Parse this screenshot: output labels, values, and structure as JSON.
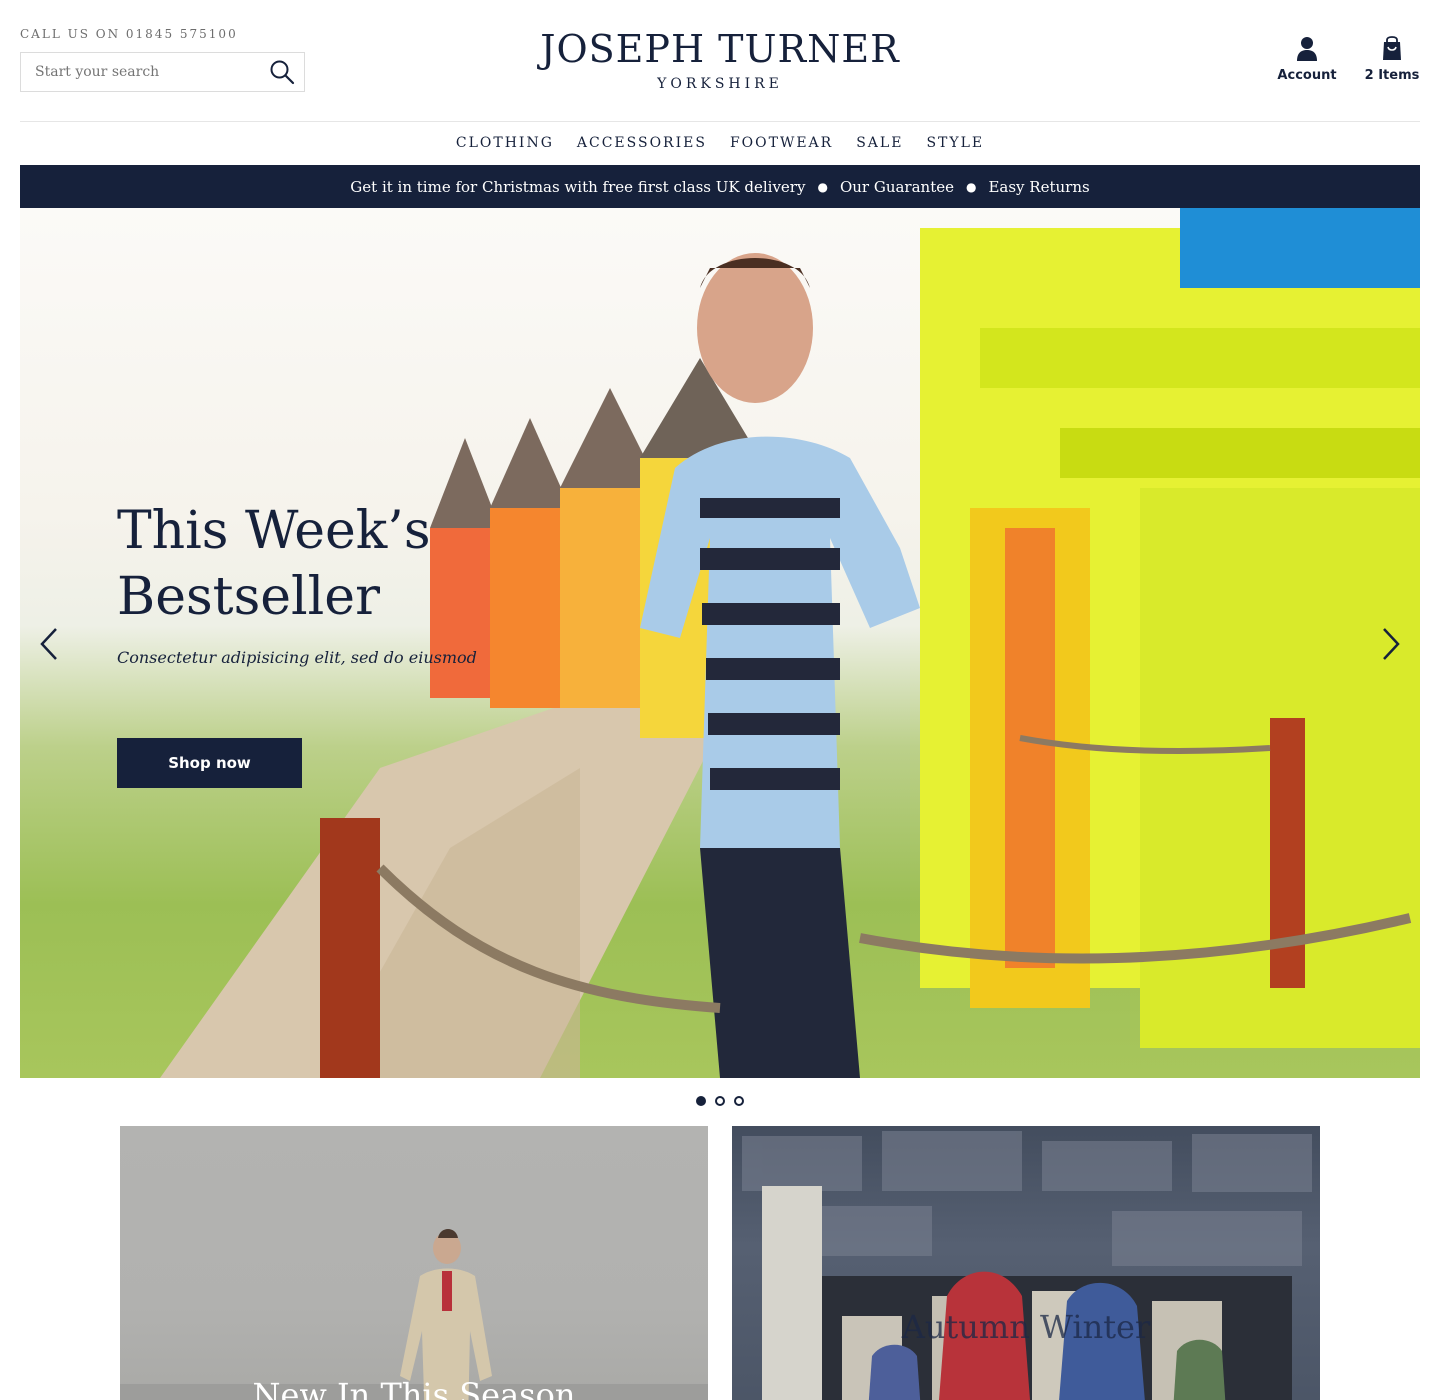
{
  "header": {
    "phone": "CALL US ON 01845 575100",
    "search_placeholder": "Start your search",
    "logo_main": "JOSEPH TURNER",
    "logo_sub": "YORKSHIRE",
    "account_label": "Account",
    "basket_label": "2 Items"
  },
  "nav": {
    "items": [
      "CLOTHING",
      "ACCESSORIES",
      "FOOTWEAR",
      "SALE",
      "STYLE"
    ]
  },
  "promo": {
    "delivery": "Get it in time for Christmas with free first class UK delivery",
    "guarantee": "Our Guarantee",
    "returns": "Easy Returns"
  },
  "hero": {
    "title": "This Week’s Bestseller",
    "subtitle": "Consectetur adipisicing elit, sed do eiusmod",
    "button": "Shop now",
    "active_slide": 1,
    "slide_count": 3
  },
  "cards": [
    {
      "title": "New In This Season"
    },
    {
      "title": "Autumn Winter"
    }
  ],
  "colors": {
    "navy": "#16213b",
    "white": "#ffffff",
    "muted_text": "#6d6d6d"
  }
}
